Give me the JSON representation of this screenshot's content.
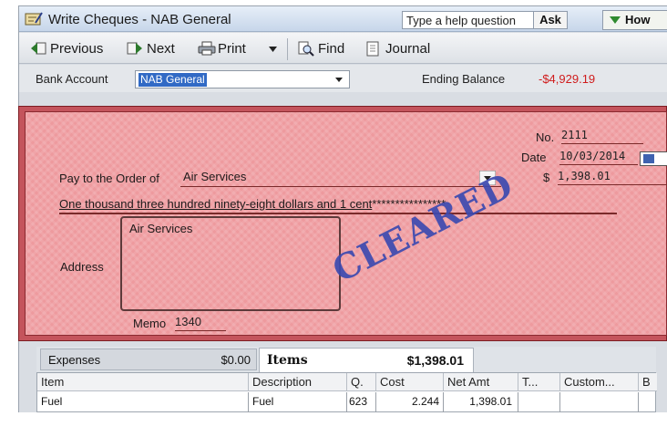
{
  "window": {
    "title": "Write Cheques - NAB General"
  },
  "help": {
    "label": "Type a help question",
    "ask": "Ask",
    "how": "How"
  },
  "toolbar": {
    "previous": "Previous",
    "next": "Next",
    "print": "Print",
    "find": "Find",
    "journal": "Journal"
  },
  "bank": {
    "label": "Bank Account",
    "account": "NAB General",
    "ending_label": "Ending Balance",
    "ending_value": "-$4,929.19"
  },
  "cheque": {
    "no_label": "No.",
    "no": "2111",
    "date_label": "Date",
    "date": "10/03/2014",
    "amount_symbol": "$",
    "amount": "1,398.01",
    "pay_to_label": "Pay to the Order of",
    "payee": "Air Services",
    "amount_words": "One thousand three hundred ninety-eight dollars and 1 cent",
    "amount_words_fill": "****************",
    "address_label": "Address",
    "address_line1": "Air Services",
    "memo_label": "Memo",
    "memo": "1340",
    "stamp": "CLEARED",
    "colors": {
      "background": "#ee9a9e",
      "border": "#c4545c",
      "stamp": "#3d4ab0"
    }
  },
  "tabs": {
    "expenses_label": "Expenses",
    "expenses_total": "$0.00",
    "items_label": "Items",
    "items_total": "$1,398.01"
  },
  "grid": {
    "headers": [
      "Item",
      "Description",
      "Q.",
      "Cost",
      "Net Amt",
      "T...",
      "Custom...",
      "B"
    ],
    "rows": [
      {
        "item": "Fuel",
        "description": "Fuel",
        "qty": "623",
        "cost": "2.244",
        "net_amt": "1,398.01"
      }
    ]
  }
}
